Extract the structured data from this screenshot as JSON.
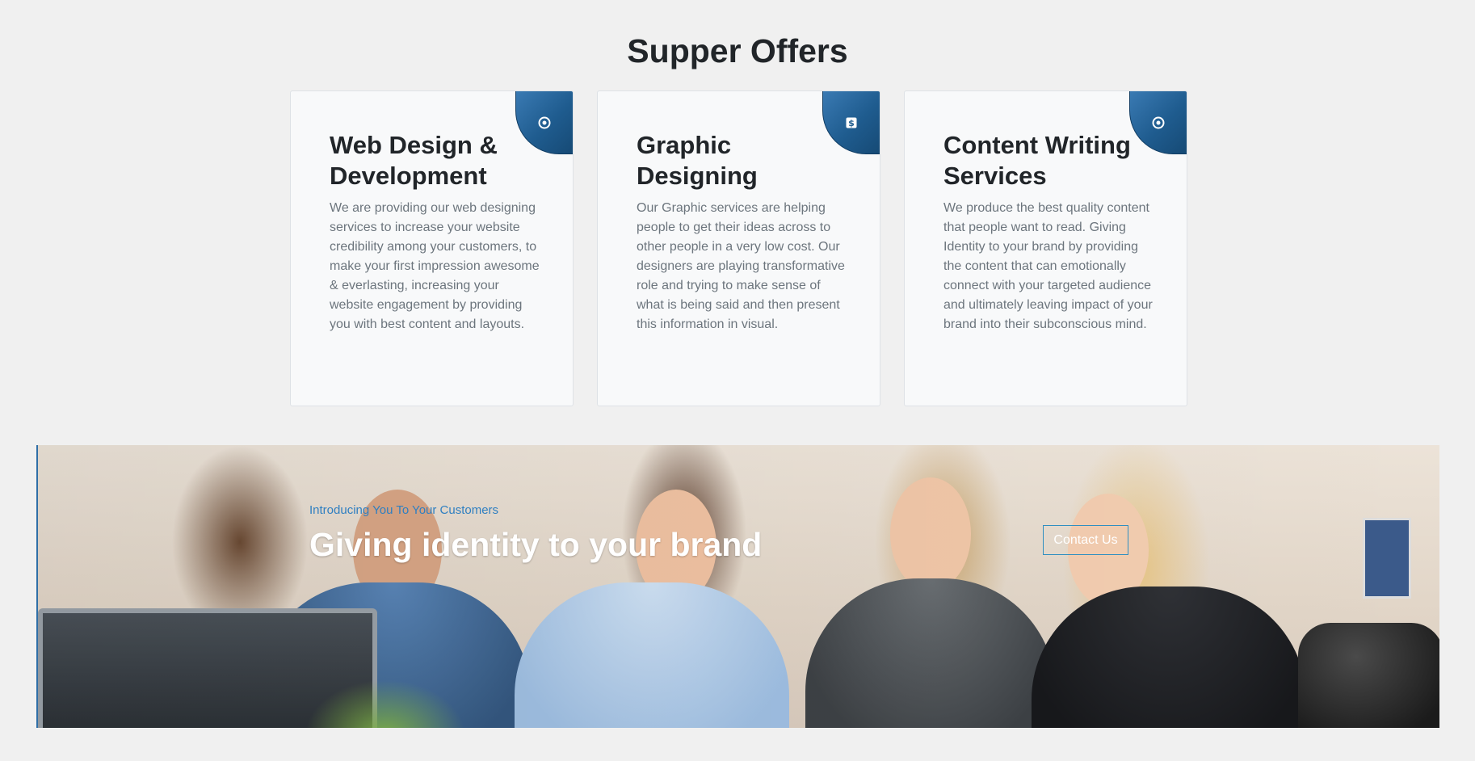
{
  "offers": {
    "title": "Supper Offers",
    "cards": [
      {
        "icon": "target-icon",
        "title": "Web Design & Development",
        "text": "We are providing our web designing services to increase your website credibility among your customers, to make your first impression awesome & everlasting, increasing your website engagement by providing you with best content and layouts."
      },
      {
        "icon": "dollar-icon",
        "title": "Graphic Designing",
        "text": "Our Graphic services are helping people to get their ideas across to other people in a very low cost. Our designers are playing transformative role and trying to make sense of what is being said and then present this information in visual."
      },
      {
        "icon": "target-icon",
        "title": "Content Writing Services",
        "text": "We produce the best quality content that people want to read. Giving Identity to your brand by providing the content that can emotionally connect with your targeted audience and ultimately leaving impact of your brand into their subconscious mind."
      }
    ]
  },
  "banner": {
    "kicker": "Introducing You To Your Customers",
    "headline": "Giving identity to your brand",
    "cta_label": "Contact Us"
  },
  "colors": {
    "accent": "#1f5c8f",
    "kicker": "#2f7fc1",
    "heading": "#212529",
    "body_text": "#6c757d"
  }
}
